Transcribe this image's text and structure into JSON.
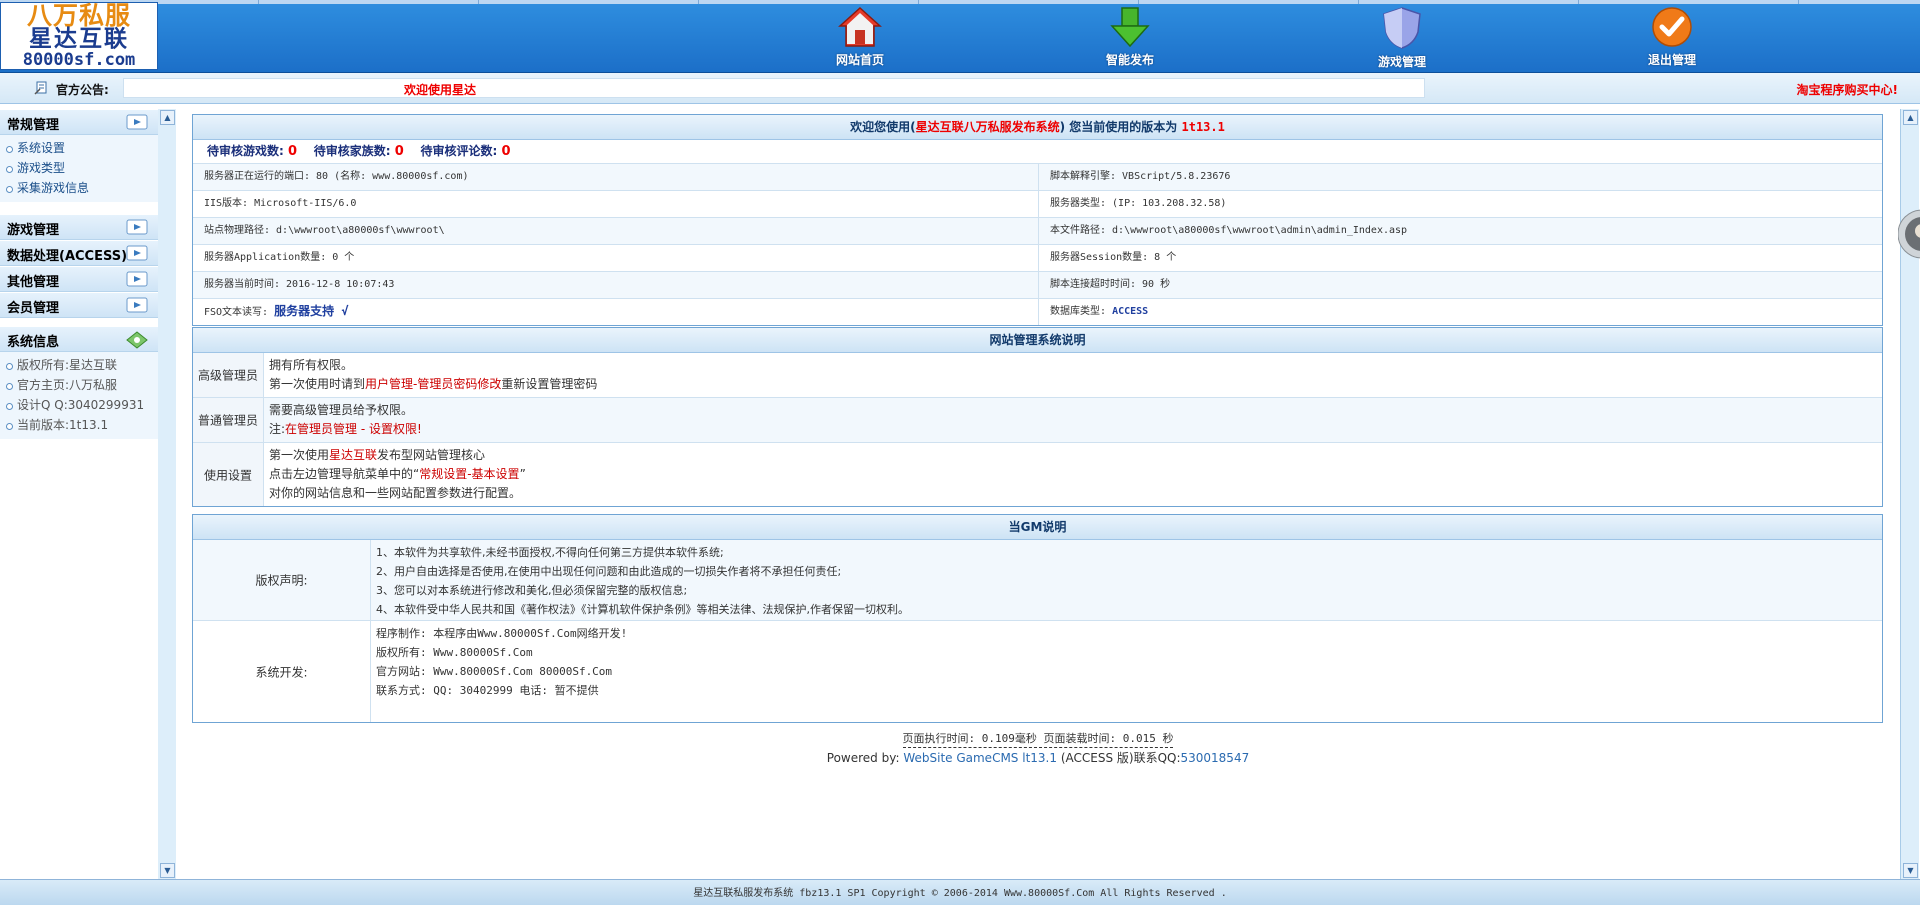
{
  "banner": {
    "logo_line1": "八万私服",
    "logo_line2": "星达互联",
    "logo_line3": "80000sf.com",
    "nav": [
      {
        "label": "网站首页",
        "icon": "home-icon"
      },
      {
        "label": "智能发布",
        "icon": "download-arrow-icon"
      },
      {
        "label": "游戏管理",
        "icon": "shield-icon"
      },
      {
        "label": "退出管理",
        "icon": "checkmark-circle-icon"
      }
    ]
  },
  "notice": {
    "title": "官方公告:",
    "message": "欢迎使用星达",
    "shop_link": "淘宝程序购买中心!"
  },
  "sidebar": {
    "groups": [
      {
        "title": "常规管理",
        "items": [
          "系统设置",
          "游戏类型",
          "采集游戏信息"
        ]
      },
      {
        "title": "游戏管理"
      },
      {
        "title": "数据处理(ACCESS)"
      },
      {
        "title": "其他管理"
      },
      {
        "title": "会员管理"
      }
    ],
    "sysinfo": {
      "title": "系统信息",
      "items": [
        "版权所有:星达互联",
        "官方主页:八万私服",
        "设计Q Q:3040299931",
        "当前版本:1t13.1"
      ]
    }
  },
  "welcome": {
    "prefix": "欢迎您使用(",
    "product": "星达互联八万私服发布系统",
    "middle": ")  您当前使用的版本为",
    "version": "1t13.1",
    "pending_games_label": "待审核游戏数:",
    "pending_games": "0",
    "pending_families_label": "待审核家族数:",
    "pending_families": "0",
    "pending_comments_label": "待审核评论数:",
    "pending_comments": "0",
    "rows": [
      {
        "l": "服务器正在运行的端口: 80 (名称: www.80000sf.com)",
        "r": "脚本解释引擎: VBScript/5.8.23676"
      },
      {
        "l": "IIS版本: Microsoft-IIS/6.0",
        "r": "服务器类型:  (IP: 103.208.32.58)"
      },
      {
        "l": "站点物理路径: d:\\wwwroot\\a80000sf\\wwwroot\\",
        "r": "本文件路径: d:\\wwwroot\\a80000sf\\wwwroot\\admin\\admin_Index.asp"
      },
      {
        "l": "服务器Application数量: 0 个",
        "r": "服务器Session数量: 8 个"
      },
      {
        "l": "服务器当前时间: 2016-12-8 10:07:43",
        "r": "脚本连接超时时间: 90 秒"
      }
    ],
    "fso_label": "FSO文本读写:",
    "fso_value": "服务器支持 √",
    "db_label": "数据库类型:",
    "db_value": "ACCESS"
  },
  "mgmt": {
    "title": "网站管理系统说明",
    "rows": [
      {
        "label": "高级管理员",
        "line1": "拥有所有权限。",
        "line2a": "第一次使用时请到",
        "line2b": "用户管理-管理员密码修改",
        "line2c": "重新设置管理密码"
      },
      {
        "label": "普通管理员",
        "line1": "需要高级管理员给予权限。",
        "line2a": "注:",
        "line2b": "在管理员管理 - 设置权限!",
        "line2c": ""
      },
      {
        "label": "使用设置",
        "line1a": "第一次使用",
        "line1b": "星达互联",
        "line1c": "发布型网站管理核心",
        "line2a": "点击左边管理导航菜单中的“",
        "line2b": "常规设置-基本设置",
        "line2c": "”",
        "line3": "对你的网站信息和一些网站配置参数进行配置。"
      }
    ]
  },
  "gm": {
    "title": "当GM说明",
    "copyright_label": "版权声明:",
    "copyright_lines": [
      "1、本软件为共享软件,未经书面授权,不得向任何第三方提供本软件系统;",
      "2、用户自由选择是否使用,在使用中出现任何问题和由此造成的一切损失作者将不承担任何责任;",
      "3、您可以对本系统进行修改和美化,但必须保留完整的版权信息;",
      "4、本软件受中华人民共和国《著作权法》《计算机软件保护条例》等相关法律、法规保护,作者保留一切权利。"
    ],
    "dev_label": "系统开发:",
    "dev_lines": [
      "程序制作: 本程序由Www.80000Sf.Com网络开发!",
      "版权所有: Www.80000Sf.Com",
      "官方网站: Www.80000Sf.Com      80000Sf.Com",
      "联系方式: QQ: 30402999  电话: 暂不提供"
    ]
  },
  "footer": {
    "runtime": "页面执行时间: 0.109毫秒  页面装载时间: 0.015 秒",
    "powered_prefix": "Powered by: ",
    "powered_link": "WebSite GameCMS lt13.1",
    "powered_suffix": " (ACCESS 版)联系QQ:",
    "powered_qq": "530018547",
    "copyright": "星达互联私服发布系统 fbz13.1 SP1    Copyright © 2006-2014 Www.80000Sf.Com All Rights Reserved ."
  },
  "colors": {
    "accent_red": "#ee0000",
    "banner_blue": "#1c6fc8",
    "panel_border": "#6fa4d4"
  }
}
